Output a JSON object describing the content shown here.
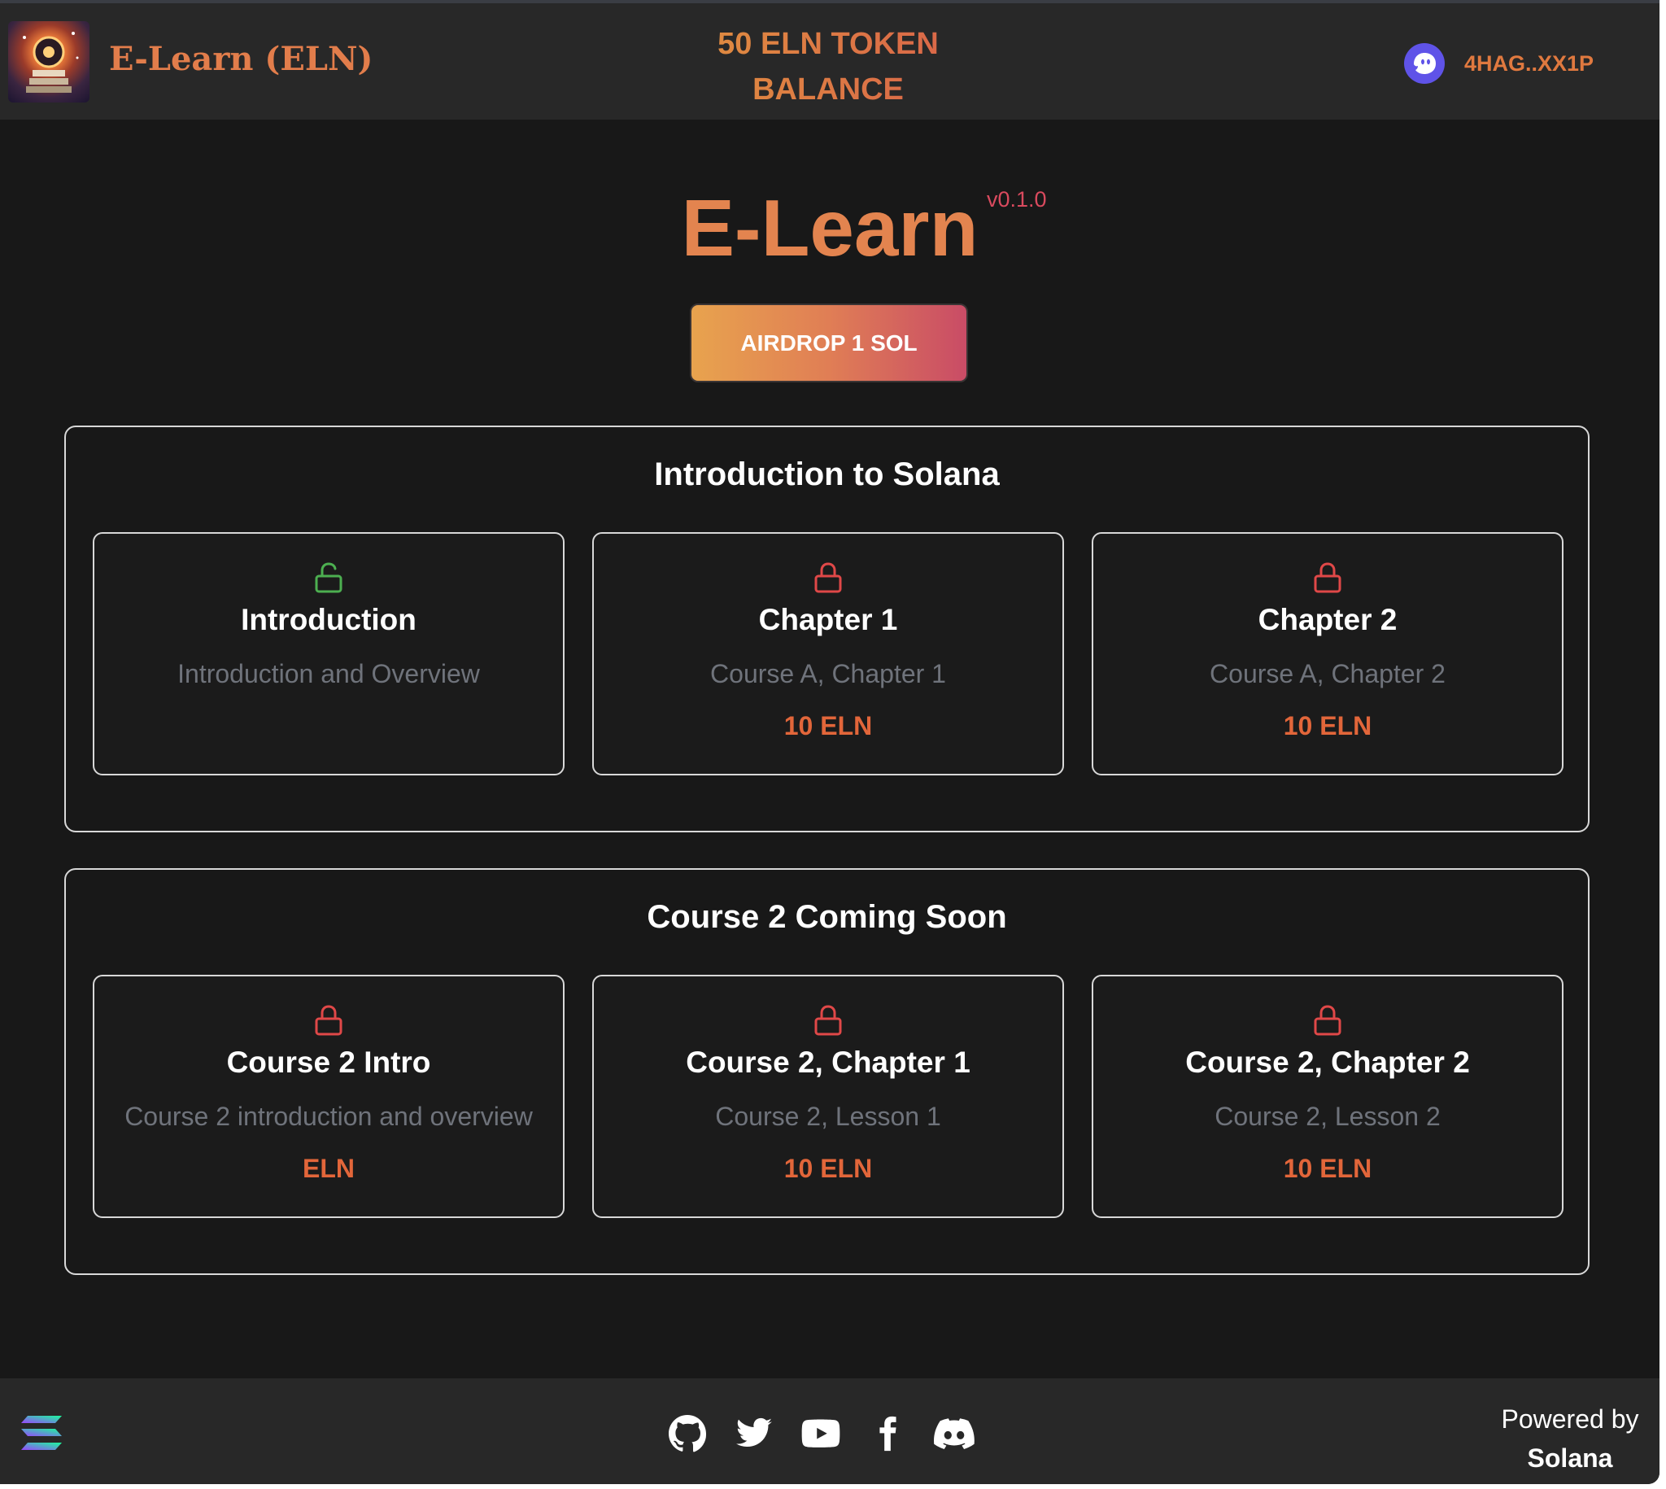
{
  "header": {
    "brand": "E-Learn (ELN)",
    "balance_line1": "50 ELN TOKEN",
    "balance_line2": "BALANCE",
    "wallet_address": "4HAG..XX1P",
    "logo_icon": "e-learn-logo",
    "wallet_icon": "phantom-ghost-icon"
  },
  "main": {
    "title": "E-Learn",
    "version": "v0.1.0",
    "airdrop_label": "AIRDROP 1 SOL"
  },
  "sections": [
    {
      "title": "Introduction to Solana",
      "cards": [
        {
          "name": "Introduction",
          "desc": "Introduction and Overview",
          "reward": "",
          "locked": false
        },
        {
          "name": "Chapter 1",
          "desc": "Course A, Chapter 1",
          "reward": "10 ELN",
          "locked": true
        },
        {
          "name": "Chapter 2",
          "desc": "Course A, Chapter 2",
          "reward": "10 ELN",
          "locked": true
        }
      ]
    },
    {
      "title": "Course 2 Coming Soon",
      "cards": [
        {
          "name": "Course 2 Intro",
          "desc": "Course 2 introduction and overview",
          "reward": "ELN",
          "locked": true
        },
        {
          "name": "Course 2, Chapter 1",
          "desc": "Course 2, Lesson 1",
          "reward": "10 ELN",
          "locked": true
        },
        {
          "name": "Course 2, Chapter 2",
          "desc": "Course 2, Lesson 2",
          "reward": "10 ELN",
          "locked": true
        }
      ]
    }
  ],
  "footer": {
    "powered_by": "Powered by",
    "powered_name": "Solana",
    "social_icons": [
      "github-icon",
      "twitter-icon",
      "youtube-icon",
      "facebook-icon",
      "discord-icon"
    ]
  },
  "colors": {
    "accent": "#e3844f",
    "unlocked": "#4caf50",
    "locked": "#e04848",
    "reward": "#e2663a"
  }
}
